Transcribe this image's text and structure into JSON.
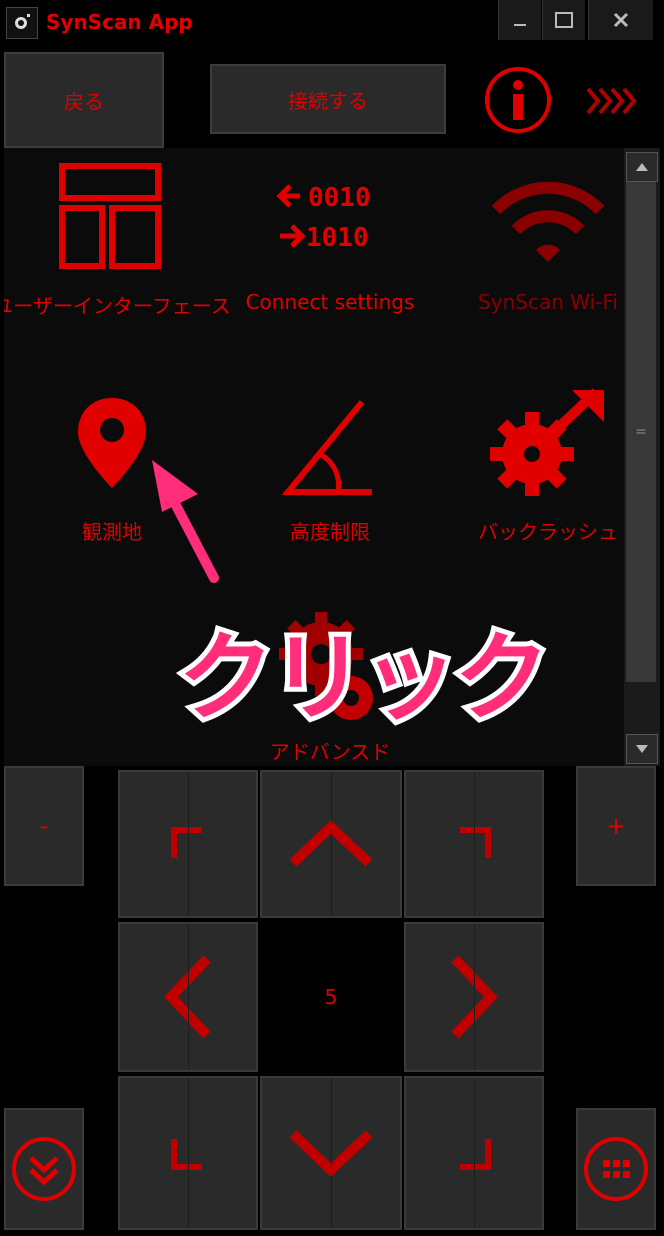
{
  "window": {
    "title": "SynScan App",
    "controls": [
      "—",
      "☐",
      "✕"
    ]
  },
  "toolbar": {
    "back_label": "戻る",
    "connect_label": "接続する",
    "info_icon": "info-icon",
    "more_icon": "chevrons-right-icon"
  },
  "menu": {
    "items": [
      {
        "label": "ユーザーインターフェース",
        "icon": "layout-icon",
        "dim": false
      },
      {
        "label": "Connect settings",
        "icon": "binary-exchange-icon",
        "dim": false
      },
      {
        "label": "SynScan Wi-Fi",
        "icon": "wifi-icon",
        "dim": true
      },
      {
        "label": "観測地",
        "icon": "location-pin-icon",
        "dim": false
      },
      {
        "label": "高度制限",
        "icon": "angle-icon",
        "dim": false
      },
      {
        "label": "バックラッシュ",
        "icon": "gear-arrow-icon",
        "dim": false
      },
      {
        "label": "アドバンスド",
        "icon": "gears-icon",
        "dim": false
      }
    ]
  },
  "scrollbar": {
    "thumb_glyph": "="
  },
  "pad": {
    "speed": "5",
    "minus_label": "-",
    "plus_label": "+"
  },
  "annotation": {
    "text": "クリック"
  },
  "colors": {
    "accent": "#e00000",
    "annotation": "#ff2d7a",
    "dim": "#8a0000"
  }
}
